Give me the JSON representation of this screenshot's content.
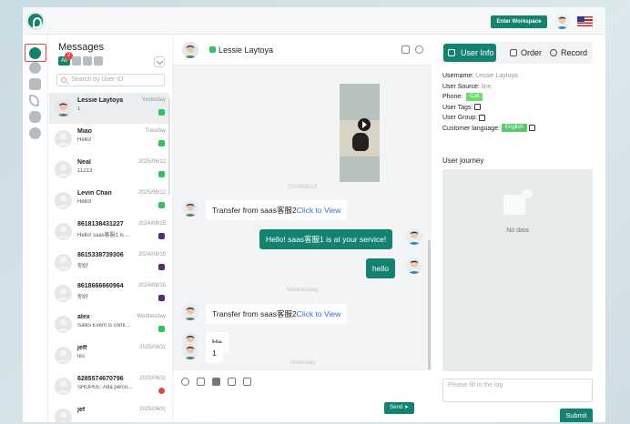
{
  "topbar": {
    "enter_workspace": "Enter Workspace"
  },
  "messages": {
    "title": "Messages",
    "filter_all": "All",
    "filter_badge": "2",
    "search_placeholder": "Search by User ID",
    "conversations": [
      {
        "name": "Lessie Laytoya",
        "time": "Yesterday",
        "preview": "1",
        "badge": "green",
        "selected": true
      },
      {
        "name": "Miao",
        "time": "Tuesday",
        "preview": "Hello!",
        "badge": "green"
      },
      {
        "name": "Neal",
        "time": "2025/06/12",
        "preview": "11213",
        "badge": "green"
      },
      {
        "name": "Levin Chan",
        "time": "2025/06/12",
        "preview": "Hello!",
        "badge": "green"
      },
      {
        "name": "8618138431227",
        "time": "2024/08/15",
        "preview": "Hello! saas客服1 is ...",
        "badge": "purple"
      },
      {
        "name": "8615338739306",
        "time": "2024/08/15",
        "preview": "你好",
        "badge": "purple"
      },
      {
        "name": "8618666660964",
        "time": "2024/08/15",
        "preview": "你好",
        "badge": "purple"
      },
      {
        "name": "alex",
        "time": "Wednesday",
        "preview": "Sales Event is comi...",
        "badge": "green"
      },
      {
        "name": "jeff",
        "time": "2025/06/2(",
        "preview": "tes",
        "badge": ""
      },
      {
        "name": "6285574670796",
        "time": "2025/06/2(",
        "preview": "SHOPEE: Ada perco...",
        "badge": "red"
      },
      {
        "name": "jef",
        "time": "2025/06/2(",
        "preview": "",
        "badge": ""
      }
    ]
  },
  "chat": {
    "contact_name": "Lessie Laytoya",
    "date_sep_1": "2024/08/13",
    "date_sep_2": "Wednesday",
    "date_sep_3": "Yesterday",
    "msg_transfer_text": "Transfer from saas客服2",
    "msg_transfer_link": "Click to View",
    "msg_hello_service": "Hello! saas客服1 is at your service!",
    "msg_hello": "hello",
    "msg_he": "He",
    "msg_one": "1",
    "send_label": "Send ➤"
  },
  "panel": {
    "tabs": [
      "User Info",
      "Order",
      "Record"
    ],
    "username_label": "Username:",
    "username_value": "Lessie Laytoya",
    "user_source_label": "User Source:",
    "user_source_value": "line",
    "phone_label": "Phone:",
    "phone_button": "Call",
    "user_tags_label": "User Tags:",
    "user_group_label": "User Group:",
    "customer_language_label": "Customer language:",
    "customer_language_value": "English",
    "journey_title": "User journey",
    "no_data": "No data",
    "log_placeholder": "Please fill in the log",
    "submit_label": "Submit"
  },
  "colors": {
    "brand": "#13836f",
    "online": "#31c35b",
    "alert": "#e0463d",
    "selection_outline": "#e0463d"
  }
}
